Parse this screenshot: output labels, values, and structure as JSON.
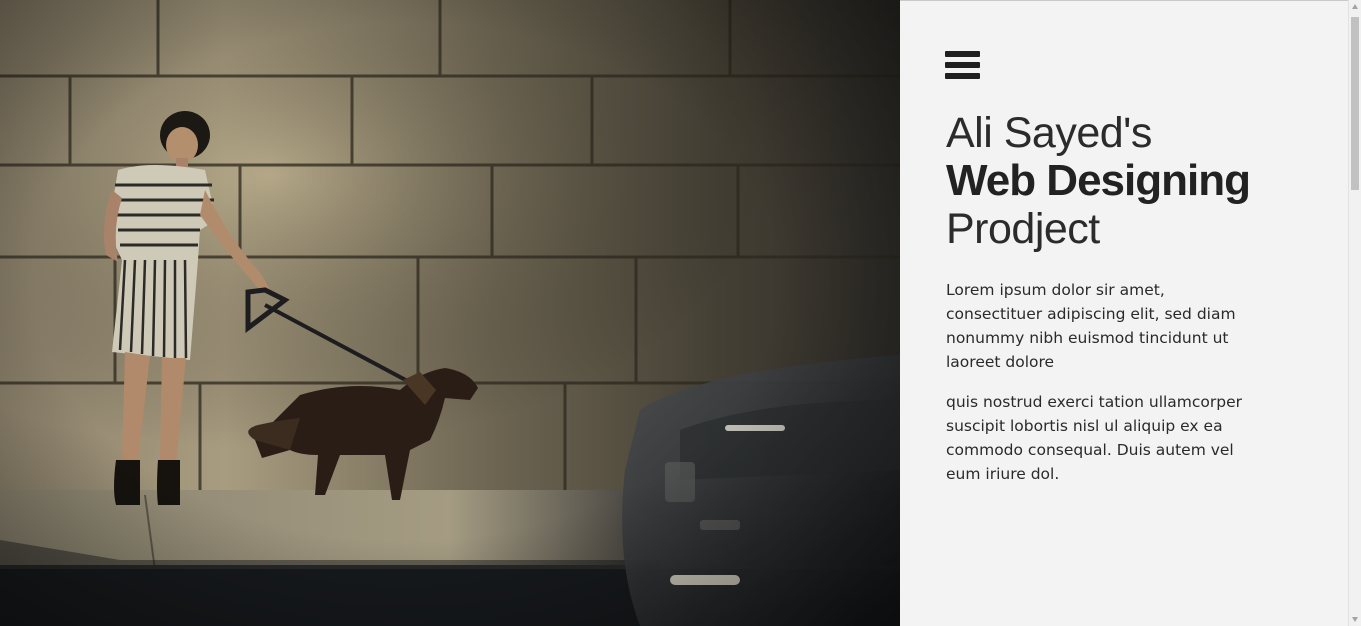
{
  "hero": {
    "image_description_icon": "woman-walking-dog-photo"
  },
  "menu": {
    "icon": "hamburger-menu-icon"
  },
  "heading": {
    "line1": "Ali Sayed's",
    "line2": "Web Designing",
    "line3": "Prodject"
  },
  "content": {
    "paragraph1": "Lorem ipsum dolor sir amet, consectituer adipiscing elit, sed diam nonummy nibh euismod tincidunt ut laoreet dolore",
    "paragraph2": "quis nostrud exerci tation ullamcorper suscipit lobortis nisl ul aliquip ex ea commodo consequal. Duis autem vel eum iriure dol."
  },
  "colors": {
    "sidebar_bg": "#f3f3f3",
    "text": "#222222"
  }
}
